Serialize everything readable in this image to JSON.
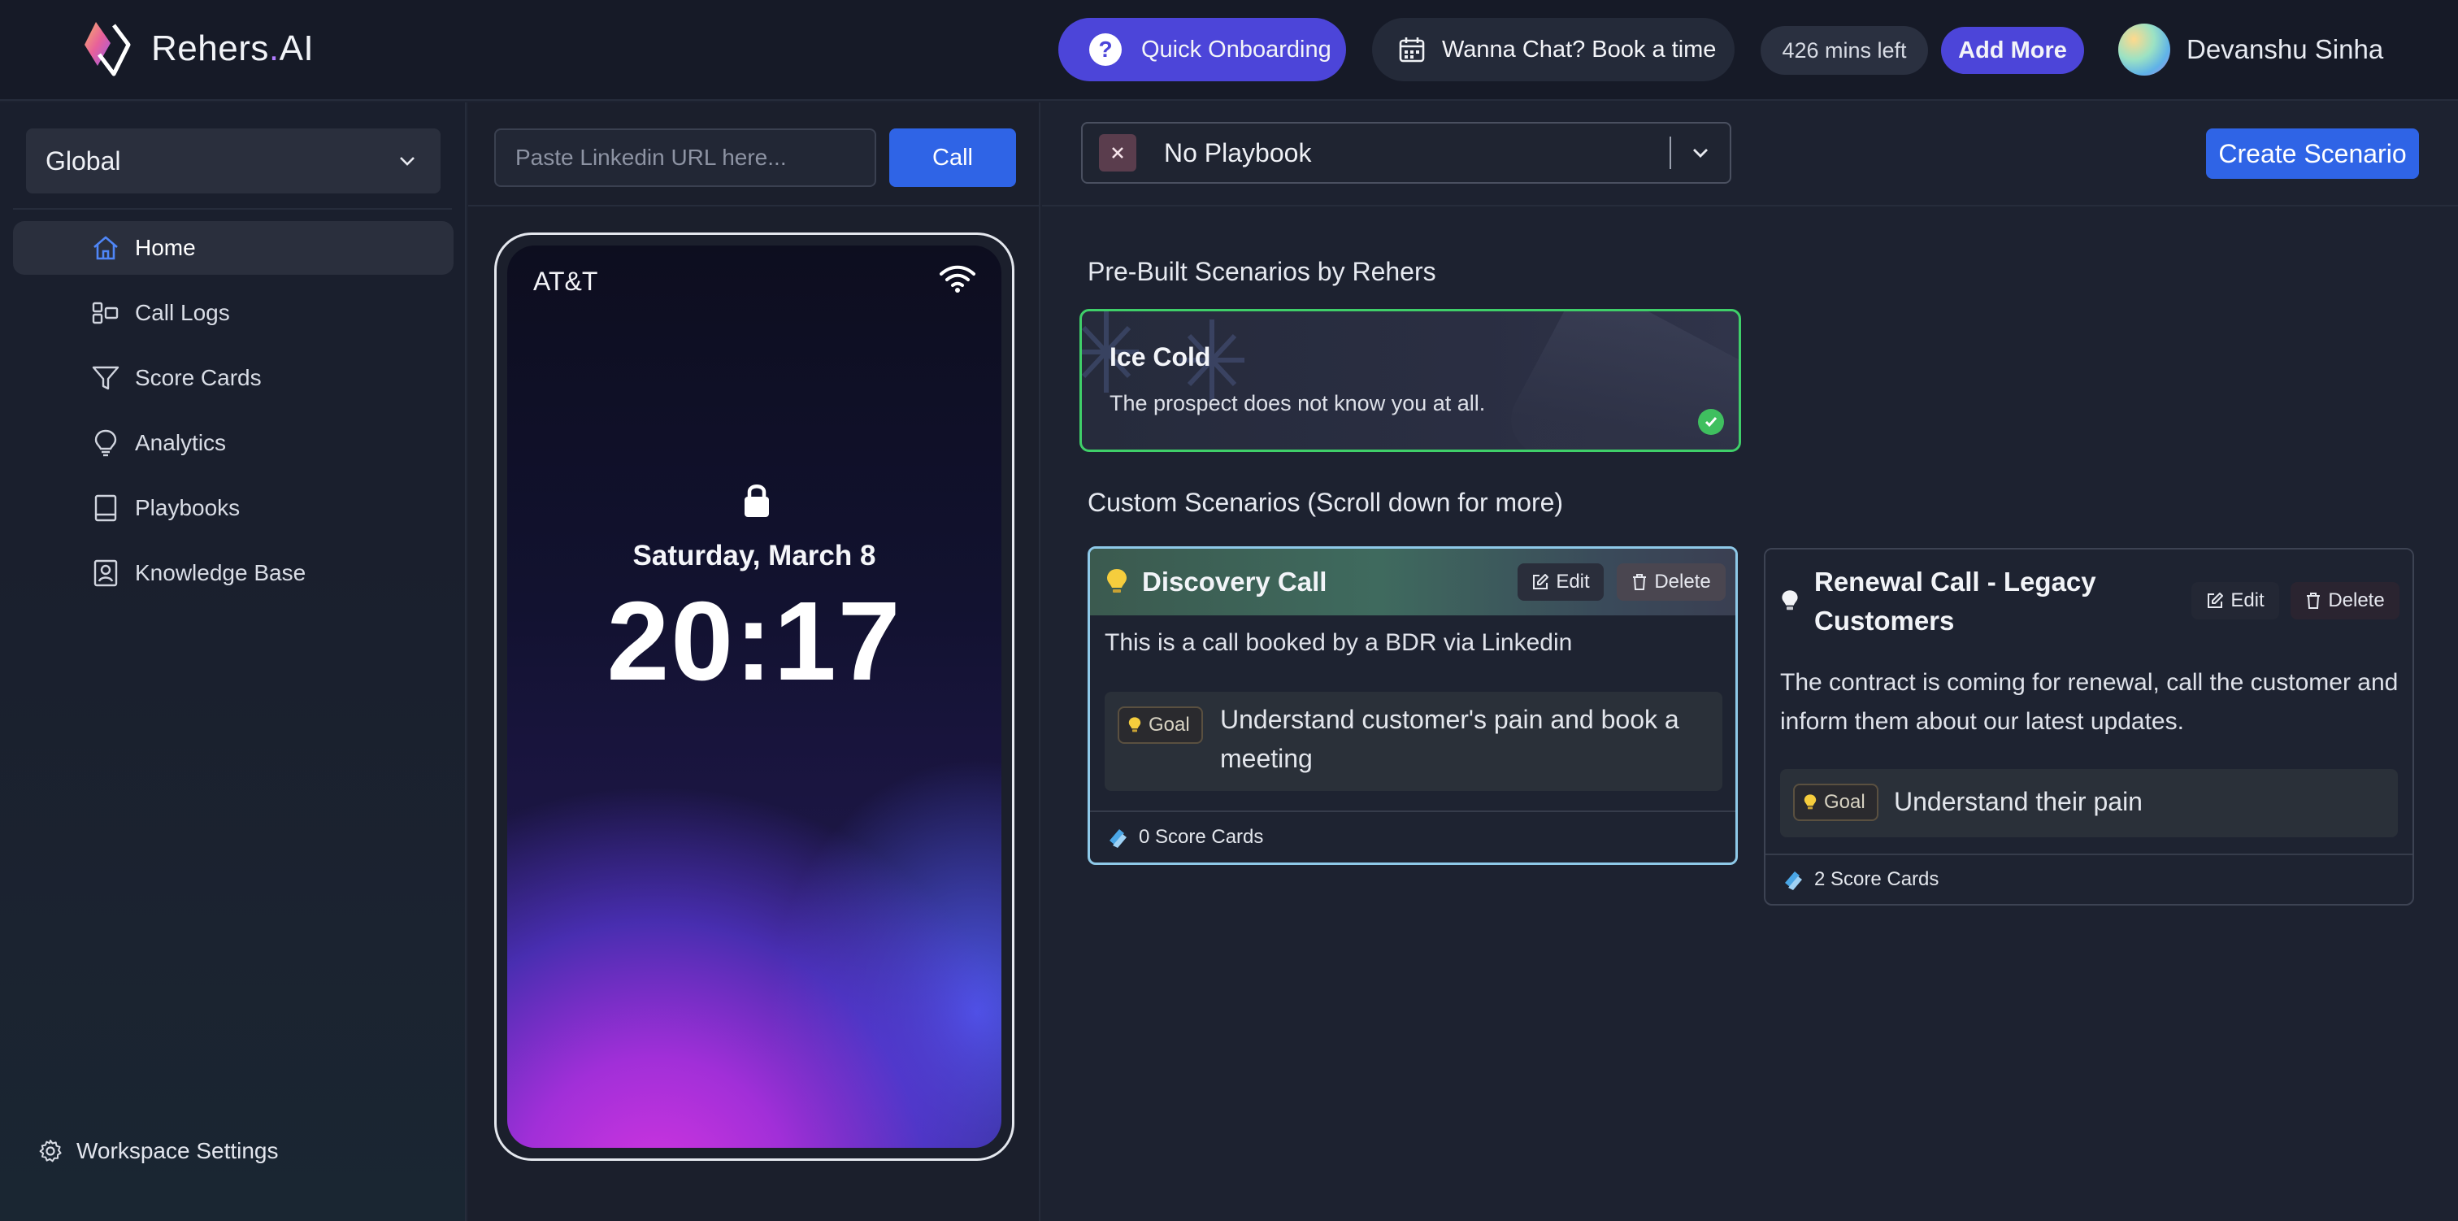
{
  "header": {
    "logo_text_a": "Rehers",
    "logo_text_dot": ".",
    "logo_text_b": "AI",
    "onboarding_label": "Quick Onboarding",
    "chat_label": "Wanna Chat? Book a time",
    "minutes_left": "426 mins left",
    "add_more_label": "Add More",
    "user_name": "Devanshu Sinha"
  },
  "sidebar": {
    "workspace": "Global",
    "items": [
      {
        "label": "Home",
        "icon": "home-icon",
        "active": true
      },
      {
        "label": "Call Logs",
        "icon": "call-logs-icon"
      },
      {
        "label": "Score Cards",
        "icon": "filter-icon"
      },
      {
        "label": "Analytics",
        "icon": "lightbulb-icon"
      },
      {
        "label": "Playbooks",
        "icon": "book-icon"
      },
      {
        "label": "Knowledge Base",
        "icon": "contact-icon"
      }
    ],
    "settings_label": "Workspace Settings"
  },
  "phone_panel": {
    "url_placeholder": "Paste Linkedin URL here...",
    "call_label": "Call",
    "carrier": "AT&T",
    "date": "Saturday, March 8",
    "time": "20:17"
  },
  "main": {
    "playbook_value": "No Playbook",
    "create_label": "Create Scenario",
    "prebuilt_title": "Pre-Built Scenarios by Rehers",
    "prebuilt": {
      "title": "Ice Cold",
      "description": "The prospect does not know you at all."
    },
    "custom_title": "Custom Scenarios (Scroll down for more)",
    "scenarios": [
      {
        "title": "Discovery Call",
        "description": "This is a call booked by a BDR via Linkedin",
        "goal_label": "Goal",
        "goal": "Understand customer's pain and book a meeting",
        "score_cards": "0 Score Cards",
        "edit_label": "Edit",
        "delete_label": "Delete"
      },
      {
        "title": "Renewal Call - Legacy Customers",
        "description": "The contract is coming for renewal, call the customer and inform them about our latest updates.",
        "goal_label": "Goal",
        "goal": "Understand their pain",
        "score_cards": "2 Score Cards",
        "edit_label": "Edit",
        "delete_label": "Delete"
      }
    ]
  },
  "colors": {
    "accent_purple": "#4c45d9",
    "accent_blue": "#2f64e6",
    "selected_green": "#3fcf69"
  }
}
